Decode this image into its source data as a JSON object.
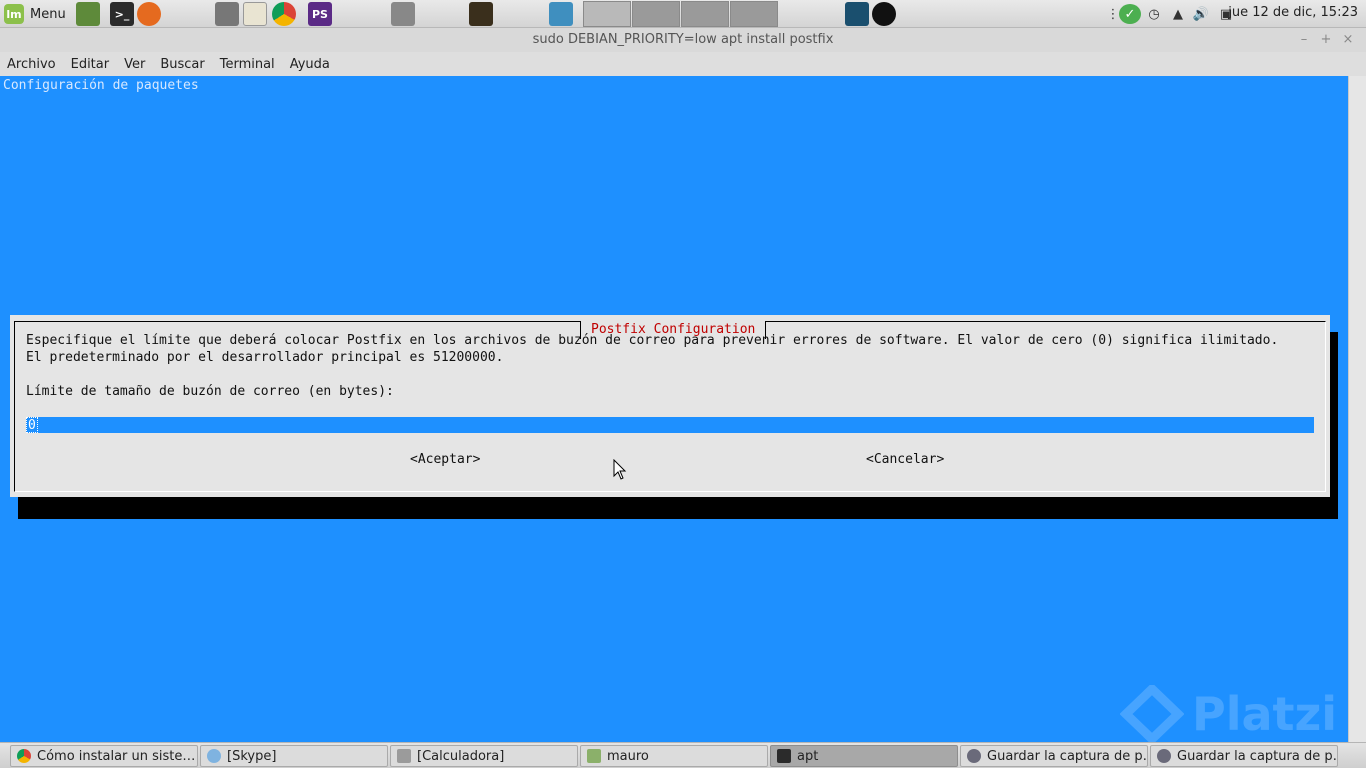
{
  "panel": {
    "menu_label": "Menu",
    "mint_logo": "lm",
    "ps_label": "PS",
    "clock": "jue 12 de dic, 15:23"
  },
  "window": {
    "title": "sudo DEBIAN_PRIORITY=low apt install postfix",
    "controls": [
      "–",
      "+",
      "×"
    ]
  },
  "menubar": [
    "Archivo",
    "Editar",
    "Ver",
    "Buscar",
    "Terminal",
    "Ayuda"
  ],
  "terminal": {
    "header": "Configuración de paquetes",
    "dialog": {
      "title": "Postfix Configuration",
      "line1": "Especifique el límite que deberá colocar Postfix en los archivos de buzón de correo para prevenir errores de software. El valor de cero (0) significa ilimitado.",
      "line2": "El predeterminado por el desarrollador principal es 51200000.",
      "prompt": "Límite de tamaño de buzón de correo (en bytes):",
      "input_value": "0",
      "ok_label": "<Aceptar>",
      "cancel_label": "<Cancelar>"
    }
  },
  "watermark": "Platzi",
  "taskbar": [
    {
      "label": "Cómo instalar un siste…",
      "icon": "chrome-icon"
    },
    {
      "label": "[Skype]",
      "icon": "skype-icon"
    },
    {
      "label": "[Calculadora]",
      "icon": "calculator-icon"
    },
    {
      "label": "mauro",
      "icon": "file-manager-icon"
    },
    {
      "label": "apt",
      "icon": "terminal-icon"
    },
    {
      "label": "Guardar la captura de p…",
      "icon": "screenshot-icon"
    },
    {
      "label": "Guardar la captura de p…",
      "icon": "screenshot-icon"
    }
  ],
  "colors": {
    "terminal_bg": "#1e90ff",
    "dialog_bg": "#e5e5e5",
    "dialog_title": "#c00000"
  }
}
